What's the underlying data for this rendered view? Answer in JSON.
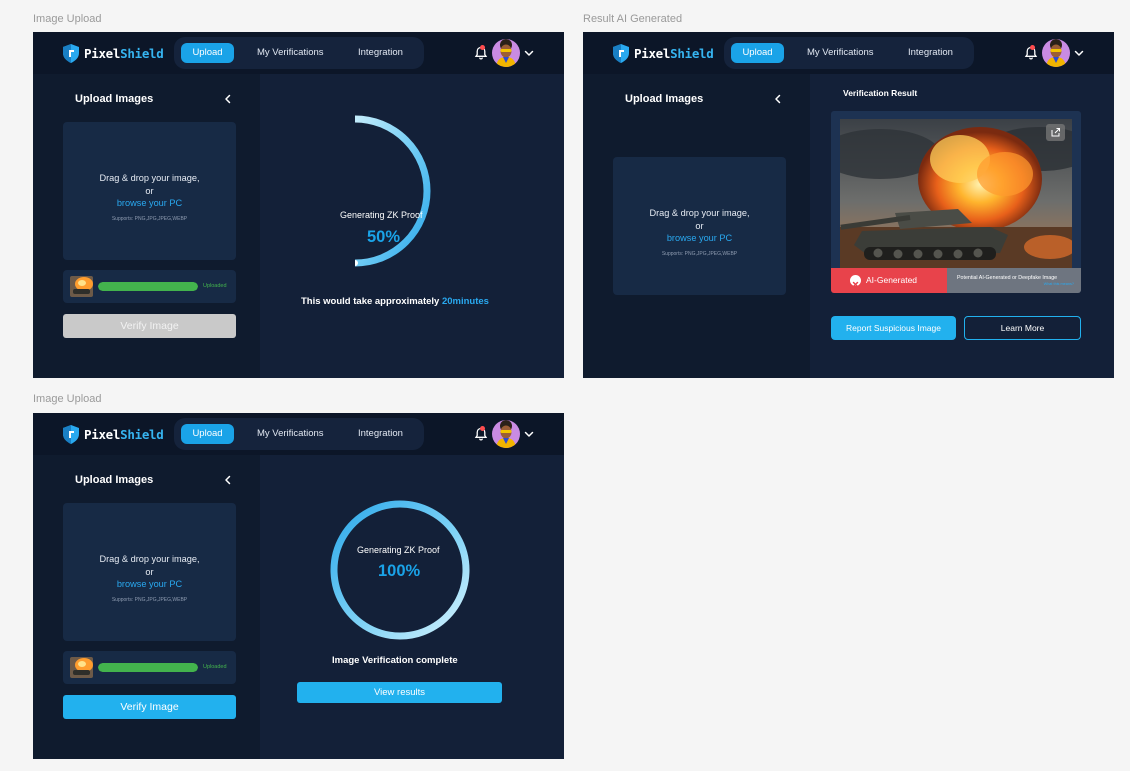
{
  "brand": {
    "name_a": "Pixel",
    "name_b": "Shield",
    "accent": "#1aa3e8",
    "success": "#43b34d",
    "danger": "#e8434b"
  },
  "nav": {
    "upload": "Upload",
    "verifications": "My Verifications",
    "integration": "Integration"
  },
  "upload_panel": {
    "title": "Upload Images",
    "drop_line1": "Drag & drop your image,",
    "drop_line2": "or",
    "browse": "browse your PC",
    "supports": "Supports: PNG,JPG,JPEG,WEBP",
    "file_status": "Uploaded",
    "file_progress": 1.0,
    "verify_label": "Verify Image"
  },
  "frames": [
    {
      "label": "Image Upload",
      "verify_enabled": false,
      "proof_label": "Generating ZK Proof",
      "proof_percent_text": "50%",
      "proof_progress": 0.5,
      "info_prefix": "This would take approximately ",
      "info_highlight": "20minutes"
    },
    {
      "label": "Result AI Generated",
      "result_title": "Verification Result",
      "ai_tag": "AI-Generated",
      "ai_desc": "Potential AI-Generated or Deepfake Image",
      "ai_link": "What this means?",
      "report_label": "Report Suspicious Image",
      "learn_label": "Learn More"
    },
    {
      "label": "Image Upload",
      "verify_enabled": true,
      "proof_label": "Generating ZK Proof",
      "proof_percent_text": "100%",
      "proof_progress": 1.0,
      "complete_text": "Image Verification complete",
      "results_label": "View results"
    }
  ]
}
